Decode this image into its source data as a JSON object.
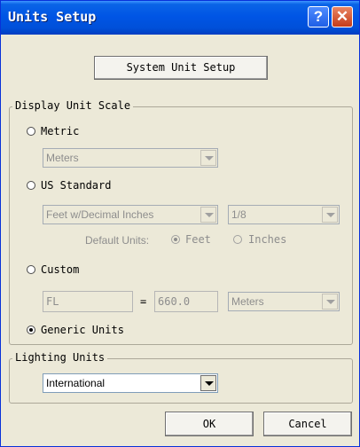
{
  "window": {
    "title": "Units Setup",
    "help_glyph": "?",
    "close_glyph": "✕"
  },
  "system_unit_button": "System Unit Setup",
  "display_group": {
    "label": "Display Unit Scale",
    "metric": {
      "label": "Metric",
      "selected": false,
      "combo_value": "Meters"
    },
    "us_standard": {
      "label": "US Standard",
      "selected": false,
      "combo_value": "Feet w/Decimal Inches",
      "fraction_value": "1/8",
      "default_units_label": "Default Units:",
      "feet_label": "Feet",
      "inches_label": "Inches",
      "feet_selected": true
    },
    "custom": {
      "label": "Custom",
      "selected": false,
      "name_value": "FL",
      "equals": "=",
      "amount_value": "660.0",
      "unit_value": "Meters"
    },
    "generic": {
      "label": "Generic Units",
      "selected": true
    }
  },
  "lighting_group": {
    "label": "Lighting Units",
    "combo_value": "International"
  },
  "buttons": {
    "ok": "OK",
    "cancel": "Cancel"
  },
  "colors": {
    "titlebar": "#0055e5",
    "face": "#ece9d8",
    "disabled_text": "#8d8d8d"
  }
}
